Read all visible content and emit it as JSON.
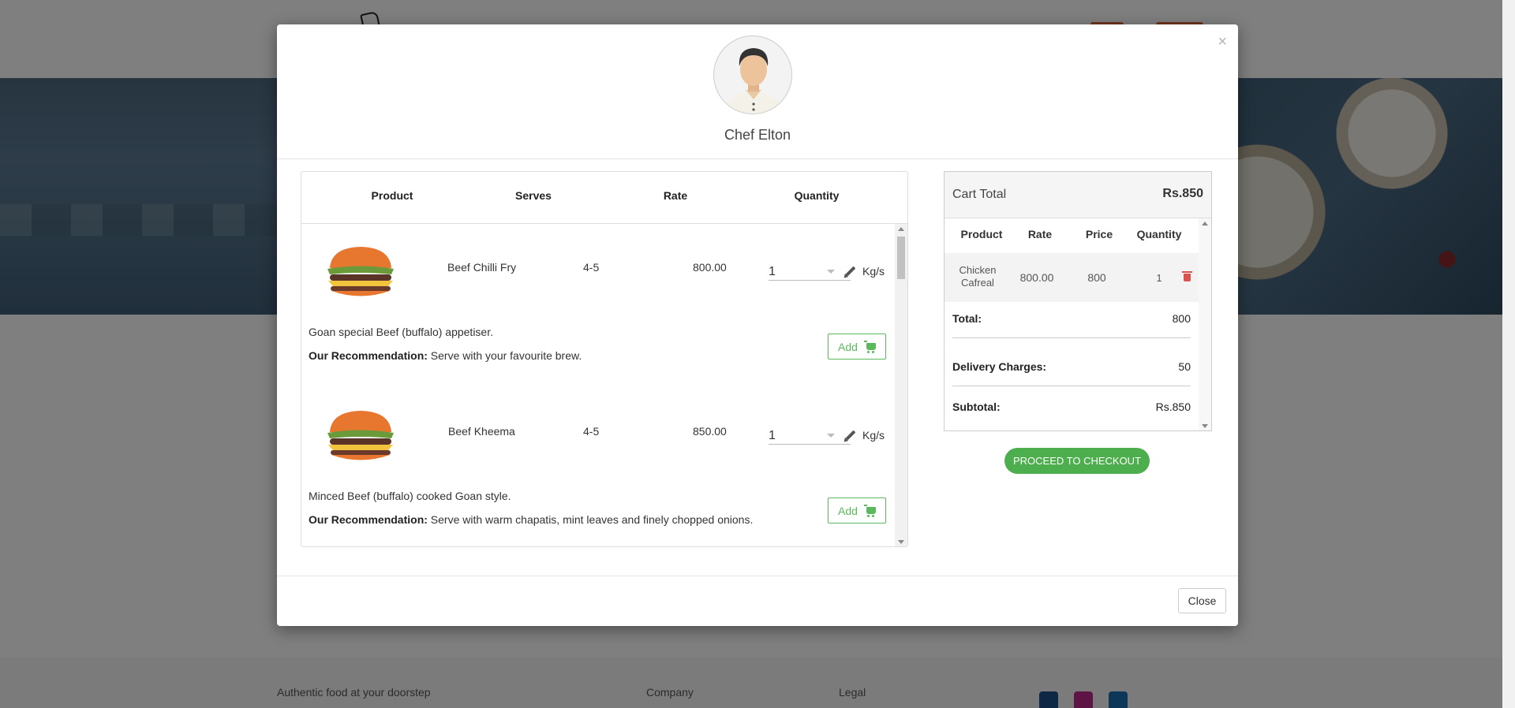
{
  "background": {
    "footer": {
      "tagline": "Authentic food at your doorstep",
      "company": "Company",
      "legal": "Legal"
    },
    "social_colors": {
      "facebook": "#1c4e8b",
      "instagram": "#bc2a8d",
      "twitter": "#1a6fb0"
    }
  },
  "modal": {
    "close_x": "×",
    "chef_name": "Chef Elton",
    "close_button": "Close"
  },
  "products": {
    "headers": {
      "product": "Product",
      "serves": "Serves",
      "rate": "Rate",
      "quantity": "Quantity"
    },
    "items": [
      {
        "name": "Beef Chilli Fry",
        "serves": "4-5",
        "rate": "800.00",
        "quantity": "1",
        "unit": "Kg/s",
        "description": "Goan special Beef (buffalo) appetiser.",
        "recommendation_label": "Our Recommendation:",
        "recommendation": "Serve with your favourite brew.",
        "add_label": "Add"
      },
      {
        "name": "Beef Kheema",
        "serves": "4-5",
        "rate": "850.00",
        "quantity": "1",
        "unit": "Kg/s",
        "description": "Minced Beef (buffalo) cooked Goan style.",
        "recommendation_label": "Our Recommendation:",
        "recommendation": "Serve with warm chapatis, mint leaves and finely chopped onions.",
        "add_label": "Add"
      }
    ]
  },
  "cart": {
    "title": "Cart Total",
    "total_top": "Rs.850",
    "headers": {
      "product": "Product",
      "rate": "Rate",
      "price": "Price",
      "quantity": "Quantity"
    },
    "rows": [
      {
        "product_line1": "Chicken",
        "product_line2": "Cafreal",
        "rate": "800.00",
        "price": "800",
        "quantity": "1"
      }
    ],
    "total_label": "Total:",
    "total_value": "800",
    "delivery_label": "Delivery Charges:",
    "delivery_value": "50",
    "subtotal_label": "Subtotal:",
    "subtotal_value": "Rs.850",
    "checkout_label": "PROCEED TO CHECKOUT"
  },
  "colors": {
    "accent_green": "#5cb85c",
    "delete_red": "#d9534f"
  }
}
